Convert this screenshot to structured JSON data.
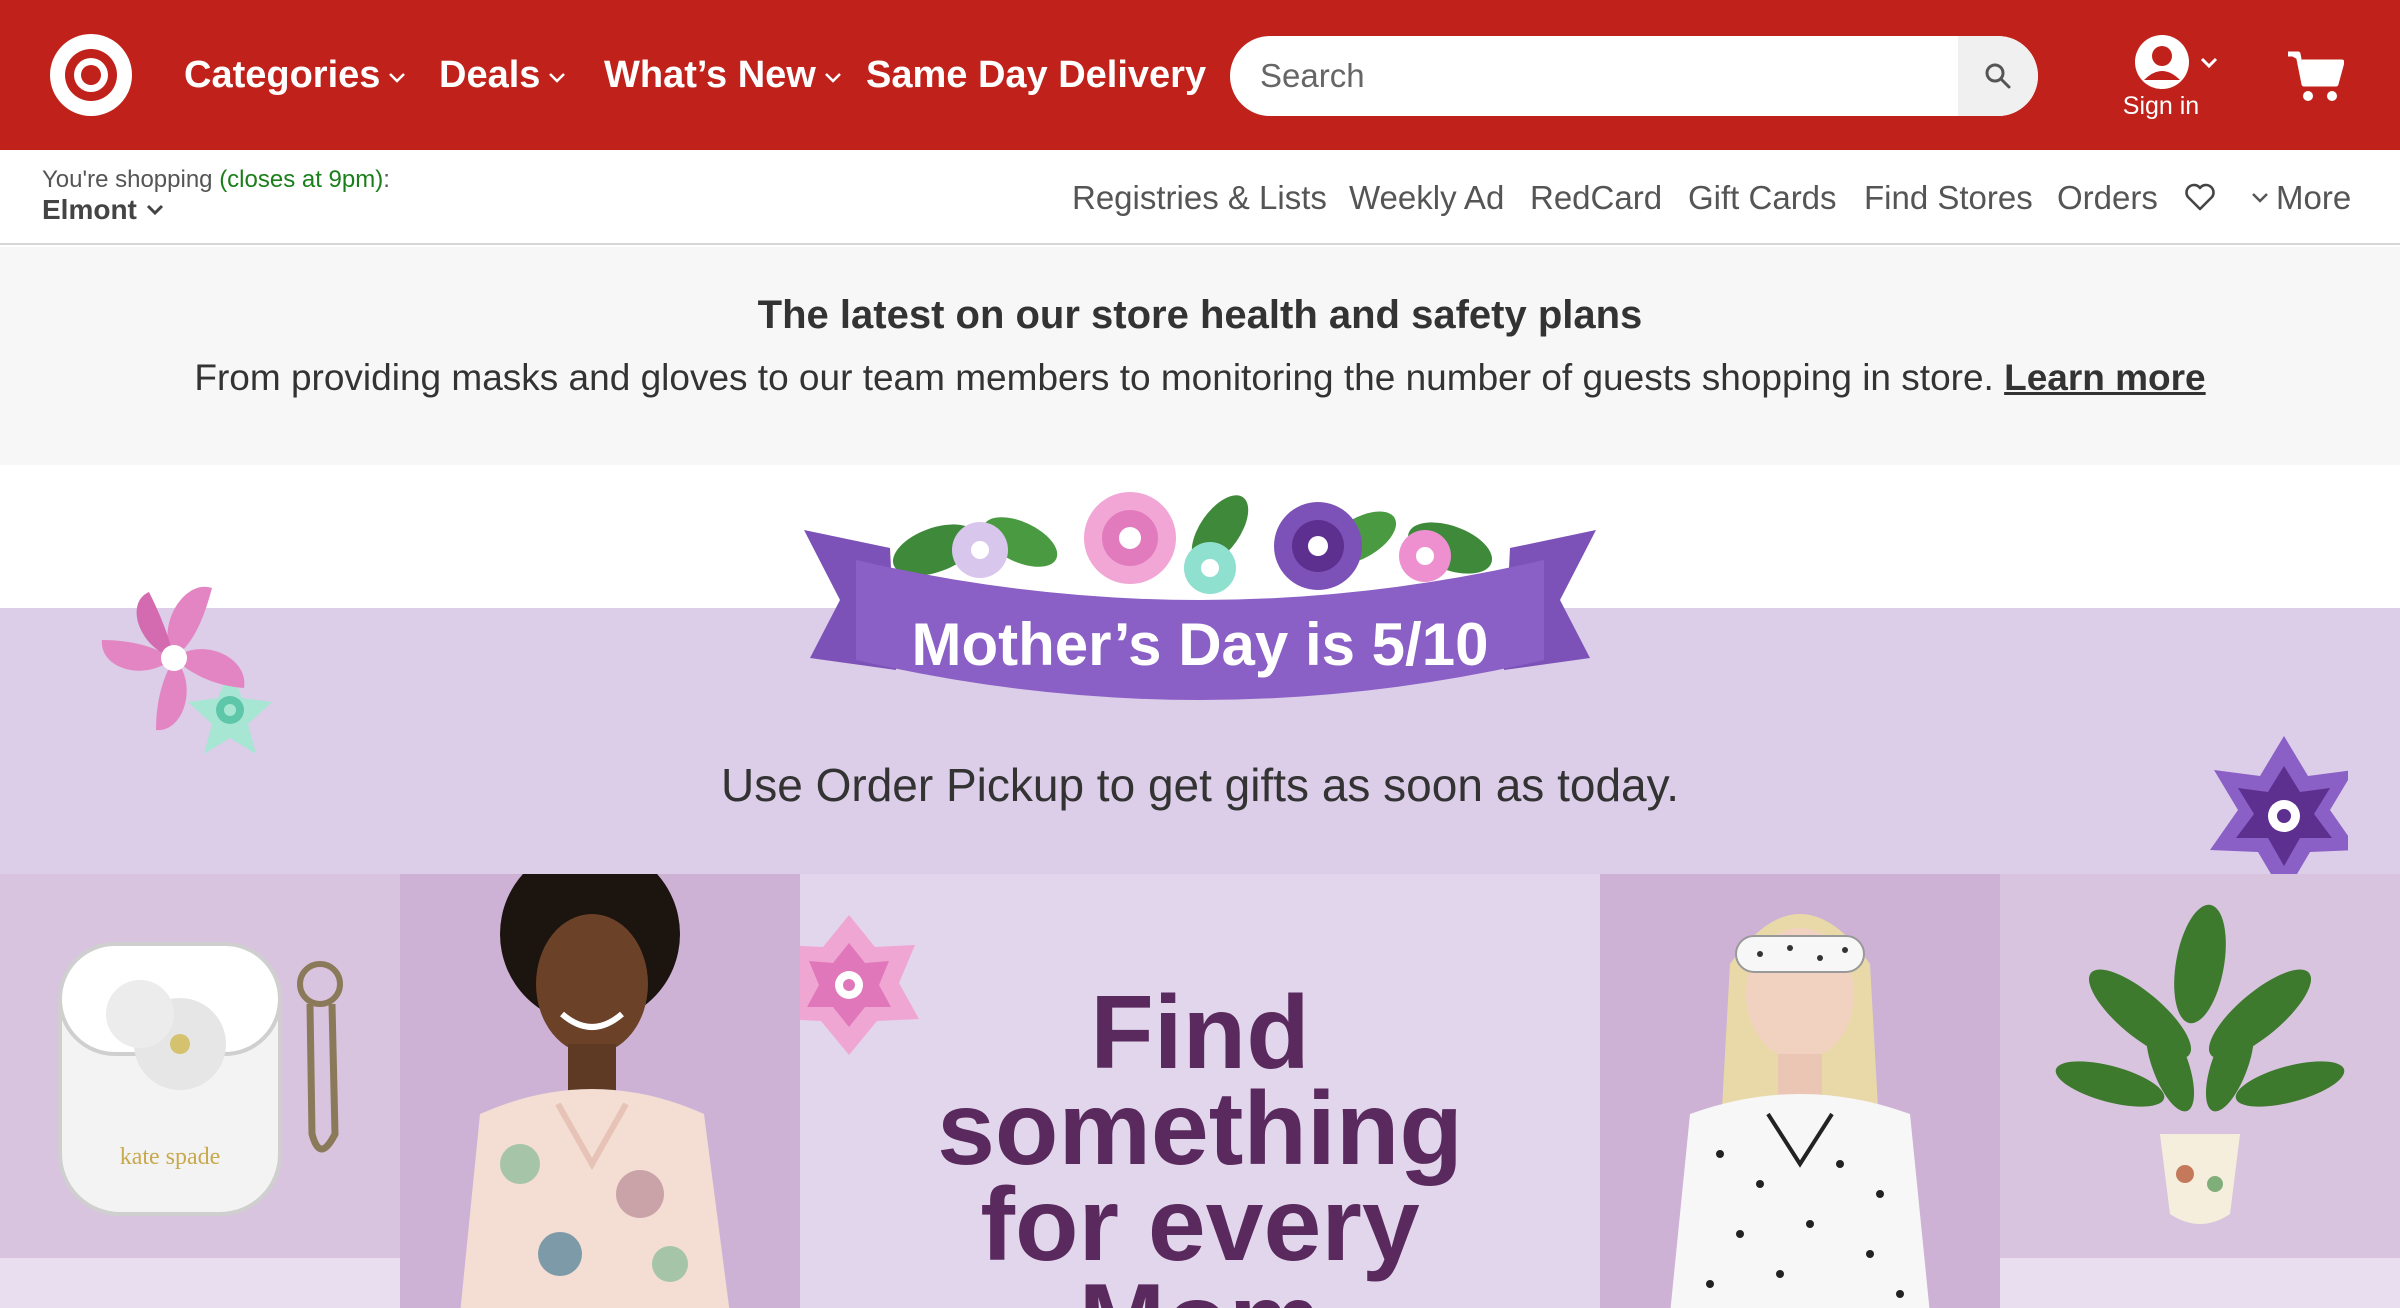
{
  "header": {
    "logo_name": "target-bullseye-logo",
    "nav": [
      {
        "label": "Categories",
        "dropdown": true
      },
      {
        "label": "Deals",
        "dropdown": true
      },
      {
        "label": "What’s New",
        "dropdown": true
      },
      {
        "label": "Same Day Delivery",
        "dropdown": false
      }
    ],
    "search": {
      "placeholder": "Search",
      "value": ""
    },
    "account_label": "Sign in",
    "brand_color": "#c0221b"
  },
  "utility": {
    "shopping_prefix": "You're shopping",
    "store_hours": "(closes at 9pm)",
    "shopping_suffix": ":",
    "store_name": "Elmont",
    "links": [
      "Registries & Lists",
      "Weekly Ad",
      "RedCard",
      "Gift Cards",
      "Find Stores",
      "Orders"
    ],
    "more_label": "More"
  },
  "safety_banner": {
    "title": "The latest on our store health and safety plans",
    "text": "From providing masks and gloves to our team members to monitoring the number of guests shopping in store.",
    "link": "Learn more"
  },
  "hero": {
    "ribbon_text": "Mother’s Day is 5/10",
    "subtitle": "Use Order Pickup to get gifts as soon as today.",
    "headline_lines": [
      "Find",
      "something",
      "for every",
      "Mom"
    ],
    "tiles": [
      "airpods-case-image",
      "woman-in-floral-pajamas-image",
      "headline-tile",
      "woman-in-polka-dot-pajamas-image",
      "potted-plant-image"
    ],
    "colors": {
      "band": "#dccde8",
      "ribbon": "#8a5fc6",
      "headline": "#5a2a5e"
    }
  }
}
